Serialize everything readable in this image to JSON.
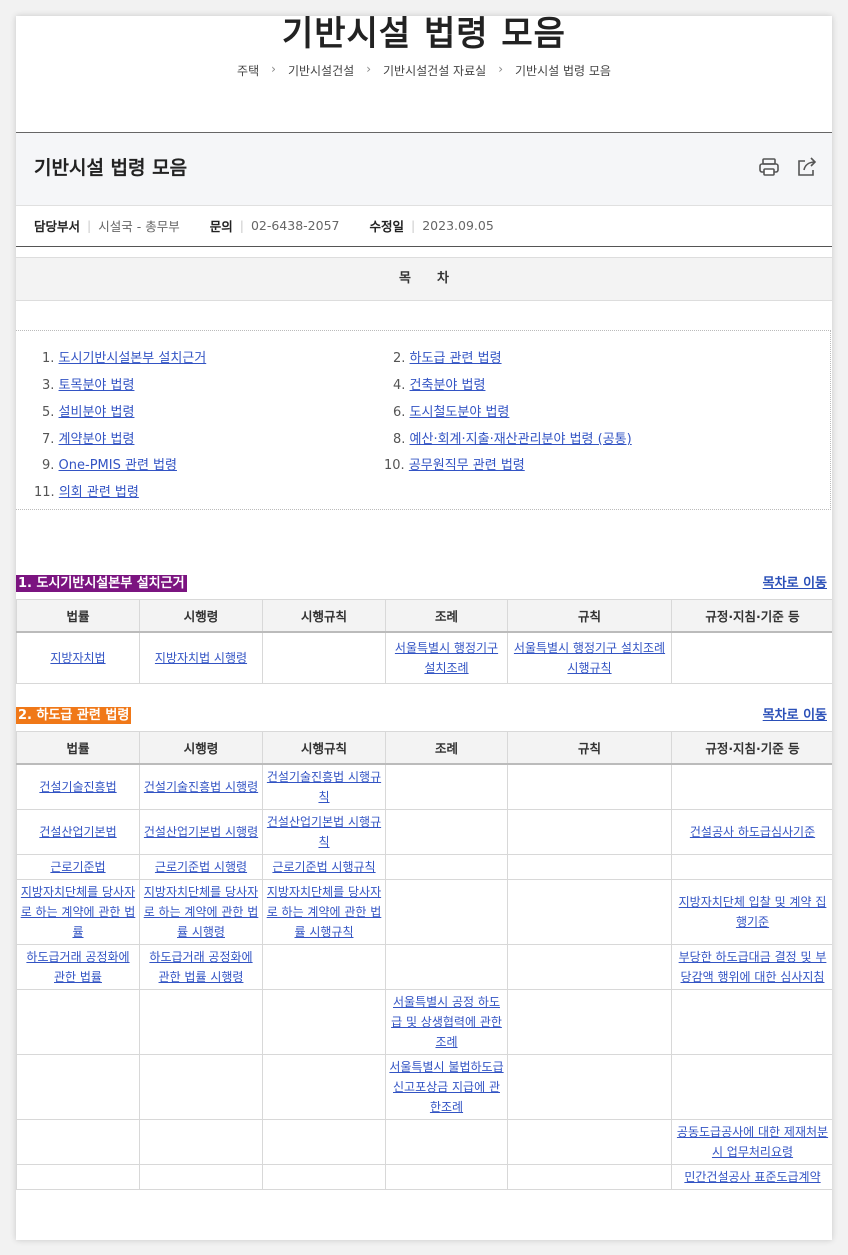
{
  "page_title": "기반시설 법령 모음",
  "breadcrumb": [
    "주택",
    "기반시설건설",
    "기반시설건설 자료실",
    "기반시설 법령 모음"
  ],
  "content_title": "기반시설 법령 모음",
  "meta": {
    "dept_label": "담당부서",
    "dept_value": "시설국 - 총무부",
    "contact_label": "문의",
    "contact_value": "02-6438-2057",
    "modified_label": "수정일",
    "modified_value": "2023.09.05"
  },
  "toc": {
    "heading": "목　　차",
    "items": [
      {
        "num": "1.",
        "label": "도시기반시설본부 설치근거"
      },
      {
        "num": "2.",
        "label": "하도급 관련 법령"
      },
      {
        "num": "3.",
        "label": "토목분야 법령"
      },
      {
        "num": "4.",
        "label": "건축분야 법령"
      },
      {
        "num": "5.",
        "label": "설비분야 법령"
      },
      {
        "num": "6.",
        "label": "도시철도분야 법령"
      },
      {
        "num": "7.",
        "label": "계약분야 법령"
      },
      {
        "num": "8.",
        "label": "예산·회계·지출·재산관리분야 법령 (공통)"
      },
      {
        "num": "9.",
        "label": "One-PMIS 관련 법령"
      },
      {
        "num": "10.",
        "label": "공무원직무 관련 법령"
      },
      {
        "num": "11.",
        "label": "의회 관련 법령"
      }
    ]
  },
  "table_headers": [
    "법률",
    "시행령",
    "시행규칙",
    "조례",
    "규칙",
    "규정·지침·기준 등"
  ],
  "go_to_toc": "목차로 이동",
  "colors": {
    "section1": "#7b1480",
    "section2": "#f07818",
    "link": "#3354c4"
  },
  "section1": {
    "label": "1. 도시기반시설본부 설치근거",
    "rows": [
      [
        "지방자치법",
        "지방자치법 시행령",
        "",
        "서울특별시 행정기구 설치조례",
        "서울특별시 행정기구 설치조례 시행규칙",
        ""
      ]
    ]
  },
  "section2": {
    "label": "2. 하도급 관련 법령",
    "rows": [
      [
        "건설기술진흥법",
        "건설기술진흥법 시행령",
        "건설기술진흥법 시행규칙",
        "",
        "",
        ""
      ],
      [
        "건설산업기본법",
        "건설산업기본법 시행령",
        "건설산업기본법 시행규칙",
        "",
        "",
        "건설공사 하도급심사기준"
      ],
      [
        "근로기준법",
        "근로기준법 시행령",
        "근로기준법 시행규칙",
        "",
        "",
        ""
      ],
      [
        "지방자치단체를 당사자로 하는 계약에 관한 법률",
        "지방자치단체를 당사자로 하는 계약에 관한 법률 시행령",
        "지방자치단체를 당사자로 하는 계약에 관한 법률 시행규칙",
        "",
        "",
        "지방자치단체 입찰 및 계약 집행기준"
      ],
      [
        "하도급거래 공정화에 관한 법률",
        "하도급거래 공정화에 관한 법률 시행령",
        "",
        "",
        "",
        "부당한 하도급대금 결정 및 부당감액 행위에 대한 심사지침"
      ],
      [
        "",
        "",
        "",
        "서울특별시 공정 하도급 및 상생협력에 관한 조례",
        "",
        ""
      ],
      [
        "",
        "",
        "",
        "서울특별시 불법하도급 신고포상금 지급에 관한조례",
        "",
        ""
      ],
      [
        "",
        "",
        "",
        "",
        "",
        "공동도급공사에 대한 제재처분시 업무처리요령"
      ],
      [
        "",
        "",
        "",
        "",
        "",
        "민간건설공사 표준도급계약"
      ]
    ]
  }
}
